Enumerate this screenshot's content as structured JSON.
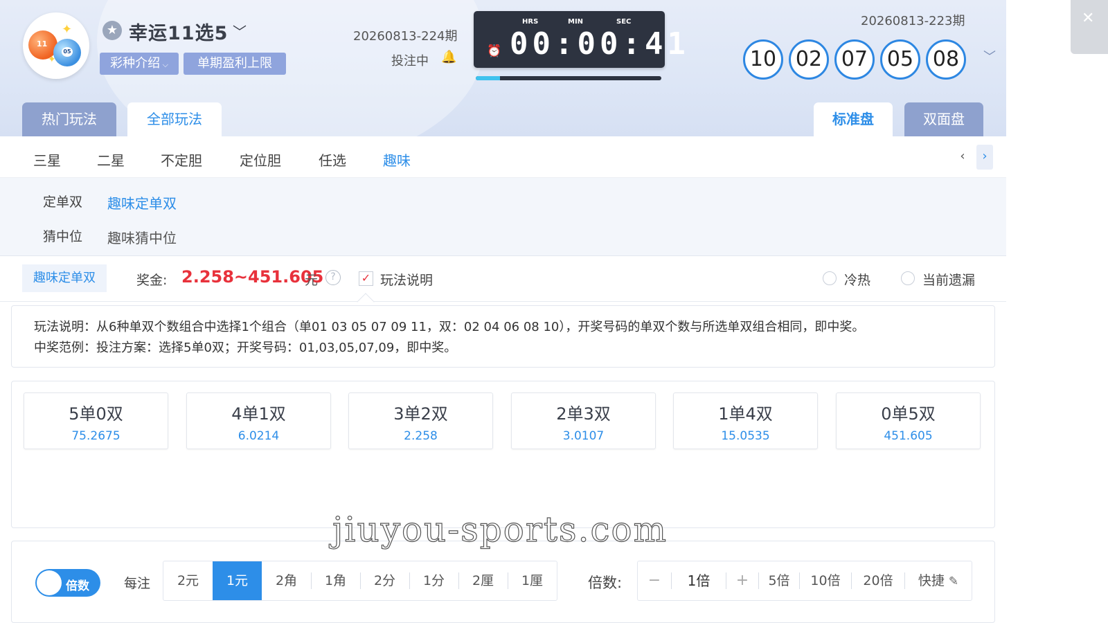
{
  "header": {
    "lottery_name": "幸运11选5",
    "tag_intro": "彩种介绍",
    "tag_limit": "单期盈利上限",
    "next_period": "20260813-224期",
    "bet_status": "投注中",
    "timer": {
      "hrs_label": "HRS",
      "min_label": "MIN",
      "sec_label": "SEC",
      "display": "00:00:41",
      "progress": 0.13
    },
    "last_period": "20260813-223期",
    "draw_numbers": [
      "10",
      "02",
      "07",
      "05",
      "08"
    ],
    "ball_1": "11",
    "ball_2": "05"
  },
  "main_tabs": {
    "hot": "热门玩法",
    "all": "全部玩法",
    "standard": "标准盘",
    "double": "双面盘"
  },
  "sub_tabs": [
    "三星",
    "二星",
    "不定胆",
    "定位胆",
    "任选",
    "趣味"
  ],
  "options": [
    {
      "label": "定单双",
      "value": "趣味定单双"
    },
    {
      "label": "猜中位",
      "value": "趣味猜中位"
    }
  ],
  "info": {
    "play_name": "趣味定单双",
    "prize_label": "奖金:",
    "prize_value": "2.258~451.605",
    "prize_unit": "元",
    "help": "?",
    "check_label": "玩法说明",
    "radio_1": "冷热",
    "radio_2": "当前遗漏"
  },
  "description": {
    "line1": "玩法说明：从6种单双个数组合中选择1个组合（单01 03 05 07 09 11，双：02 04 06 08 10），开奖号码的单双个数与所选单双组合相同，即中奖。",
    "line2": "中奖范例：投注方案：选择5单0双；开奖号码：01,03,05,07,09，即中奖。"
  },
  "combos": [
    {
      "name": "5单0双",
      "odds": "75.2675"
    },
    {
      "name": "4单1双",
      "odds": "6.0214"
    },
    {
      "name": "3单2双",
      "odds": "2.258"
    },
    {
      "name": "2单3双",
      "odds": "3.0107"
    },
    {
      "name": "1单4双",
      "odds": "15.0535"
    },
    {
      "name": "0单5双",
      "odds": "451.605"
    }
  ],
  "bottom": {
    "toggle_label": "倍数",
    "unit_label": "每注",
    "units": [
      "2元",
      "1元",
      "2角",
      "1角",
      "2分",
      "1分",
      "2厘",
      "1厘"
    ],
    "selected_unit": "1元",
    "mult_label": "倍数:",
    "minus": "−",
    "mult_value": "1倍",
    "plus": "+",
    "quick_multiples": [
      "5倍",
      "10倍",
      "20倍"
    ],
    "quick_label": "快捷"
  },
  "watermark": "jiuyou-sports.com",
  "icons": {
    "star": "star-icon",
    "bell": "bell-icon",
    "alarm": "alarm-clock-icon",
    "close": "close-icon",
    "edit": "edit-icon"
  },
  "colors": {
    "accent": "#2d8ee8",
    "prize": "#e8313b",
    "tab_inactive": "#8ea1ce",
    "timer_bg": "#2d3340"
  }
}
